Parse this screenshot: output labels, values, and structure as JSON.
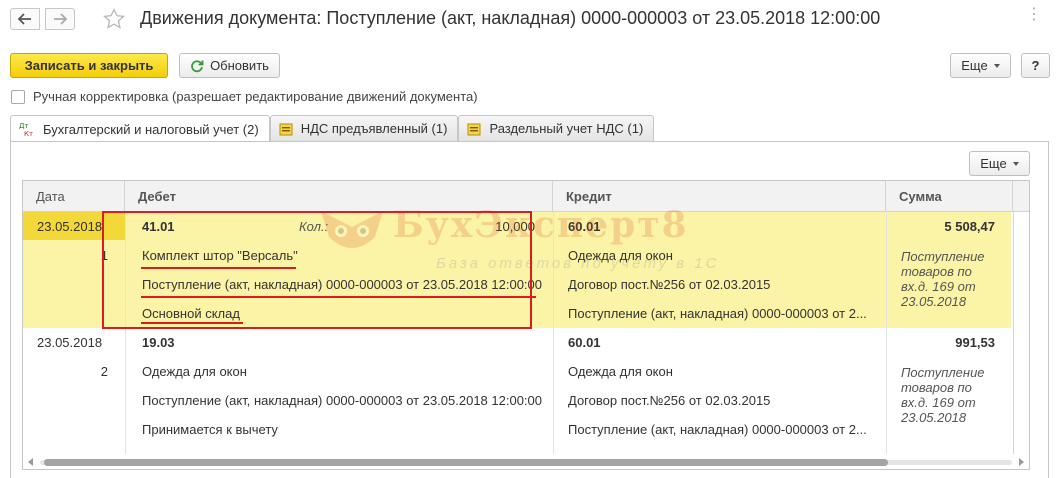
{
  "window": {
    "title": "Движения документа: Поступление (акт, накладная) 0000-000003 от 23.05.2018 12:00:00"
  },
  "toolbar": {
    "save_close_label": "Записать и закрыть",
    "refresh_label": "Обновить",
    "more_label": "Еще",
    "help_label": "?"
  },
  "manual_edit": {
    "label": "Ручная корректировка (разрешает редактирование движений документа)",
    "checked": false
  },
  "tabs": [
    {
      "label": "Бухгалтерский и налоговый учет (2)",
      "icon": "dt-kt-icon",
      "active": true
    },
    {
      "label": "НДС предъявленный (1)",
      "icon": "register-icon",
      "active": false
    },
    {
      "label": "Раздельный учет НДС (1)",
      "icon": "register-icon",
      "active": false
    }
  ],
  "table": {
    "more_label": "Еще",
    "columns": {
      "date": "Дата",
      "debit": "Дебет",
      "credit": "Кредит",
      "sum": "Сумма"
    },
    "rows": [
      {
        "date": "23.05.2018",
        "num": "1",
        "debit_account": "41.01",
        "qty_label": "Кол.:",
        "qty": "10,000",
        "debit_sub1": "Комплект штор \"Версаль\"",
        "debit_sub2": "Поступление (акт, накладная) 0000-000003 от 23.05.2018 12:00:00",
        "debit_sub3": "Основной склад",
        "credit_account": "60.01",
        "credit_sub1": "Одежда для окон",
        "credit_sub2": "Договор пост.№256 от 02.03.2015",
        "credit_sub3": "Поступление (акт, накладная) 0000-000003 от 2...",
        "sum": "5 508,47",
        "content": [
          "Поступление",
          "товаров по",
          "вх.д. 169 от",
          "23.05.2018"
        ],
        "selected": true
      },
      {
        "date": "23.05.2018",
        "num": "2",
        "debit_account": "19.03",
        "debit_sub1": "Одежда для окон",
        "debit_sub2": "Поступление (акт, накладная) 0000-000003 от 23.05.2018 12:00:00",
        "debit_sub3": "Принимается к вычету",
        "credit_account": "60.01",
        "credit_sub1": "Одежда для окон",
        "credit_sub2": "Договор пост.№256 от 02.03.2015",
        "credit_sub3": "Поступление (акт, накладная) 0000-000003 от 2...",
        "sum": "991,53",
        "content": [
          "Поступление",
          "товаров по",
          "вх.д. 169 от",
          "23.05.2018"
        ],
        "selected": false
      }
    ]
  },
  "watermark": {
    "brand": "БухЭксперт8",
    "tagline": "База ответов по учету в 1С"
  },
  "colors": {
    "accent_yellow": "#f4cd0a",
    "selected_row": "#fbf3a5",
    "annotation_red": "#d81e1e"
  }
}
